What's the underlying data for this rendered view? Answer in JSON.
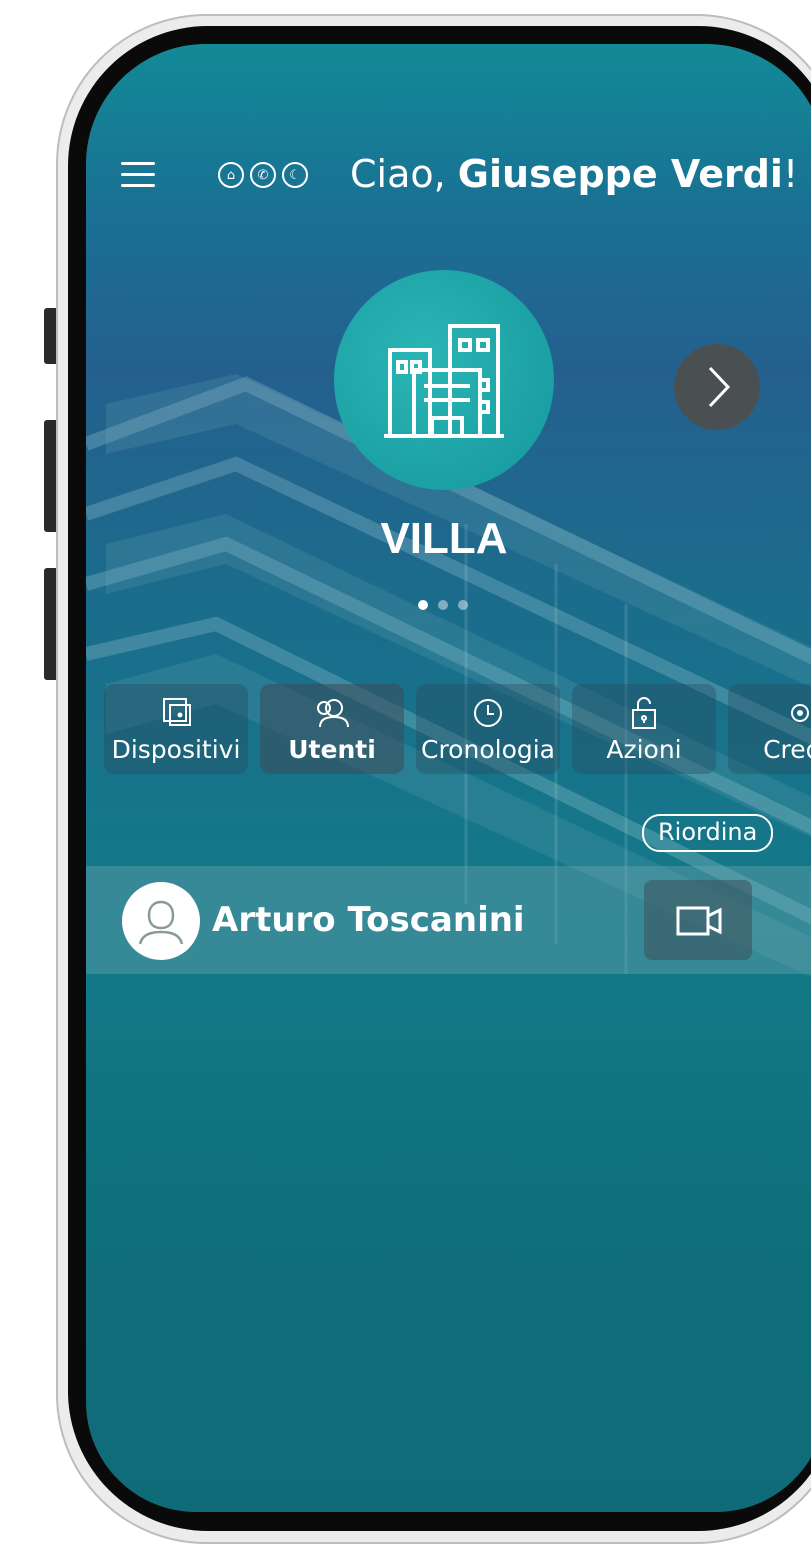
{
  "header": {
    "greeting_prefix": "Ciao, ",
    "user_name": "Giuseppe Verdi",
    "greeting_suffix": "!",
    "status_icons": [
      "home-icon",
      "phone-icon",
      "moon-icon"
    ]
  },
  "site": {
    "name": "VILLA",
    "page_dots": 3,
    "active_dot": 0
  },
  "tabs": [
    {
      "label": "Dispositivi",
      "icon": "devices-icon"
    },
    {
      "label": "Utenti",
      "icon": "users-icon",
      "active": true
    },
    {
      "label": "Cronologia",
      "icon": "clock-icon"
    },
    {
      "label": "Azioni",
      "icon": "unlock-icon"
    },
    {
      "label": "Crede",
      "icon": "credentials-icon"
    }
  ],
  "reorder_label": "Riordina",
  "users": [
    {
      "name": "Arturo Toscanini",
      "action_icon": "video-camera-icon"
    }
  ],
  "colors": {
    "accent": "#14979d",
    "background_top": "#128a96",
    "background_bottom": "#0f6b77"
  }
}
